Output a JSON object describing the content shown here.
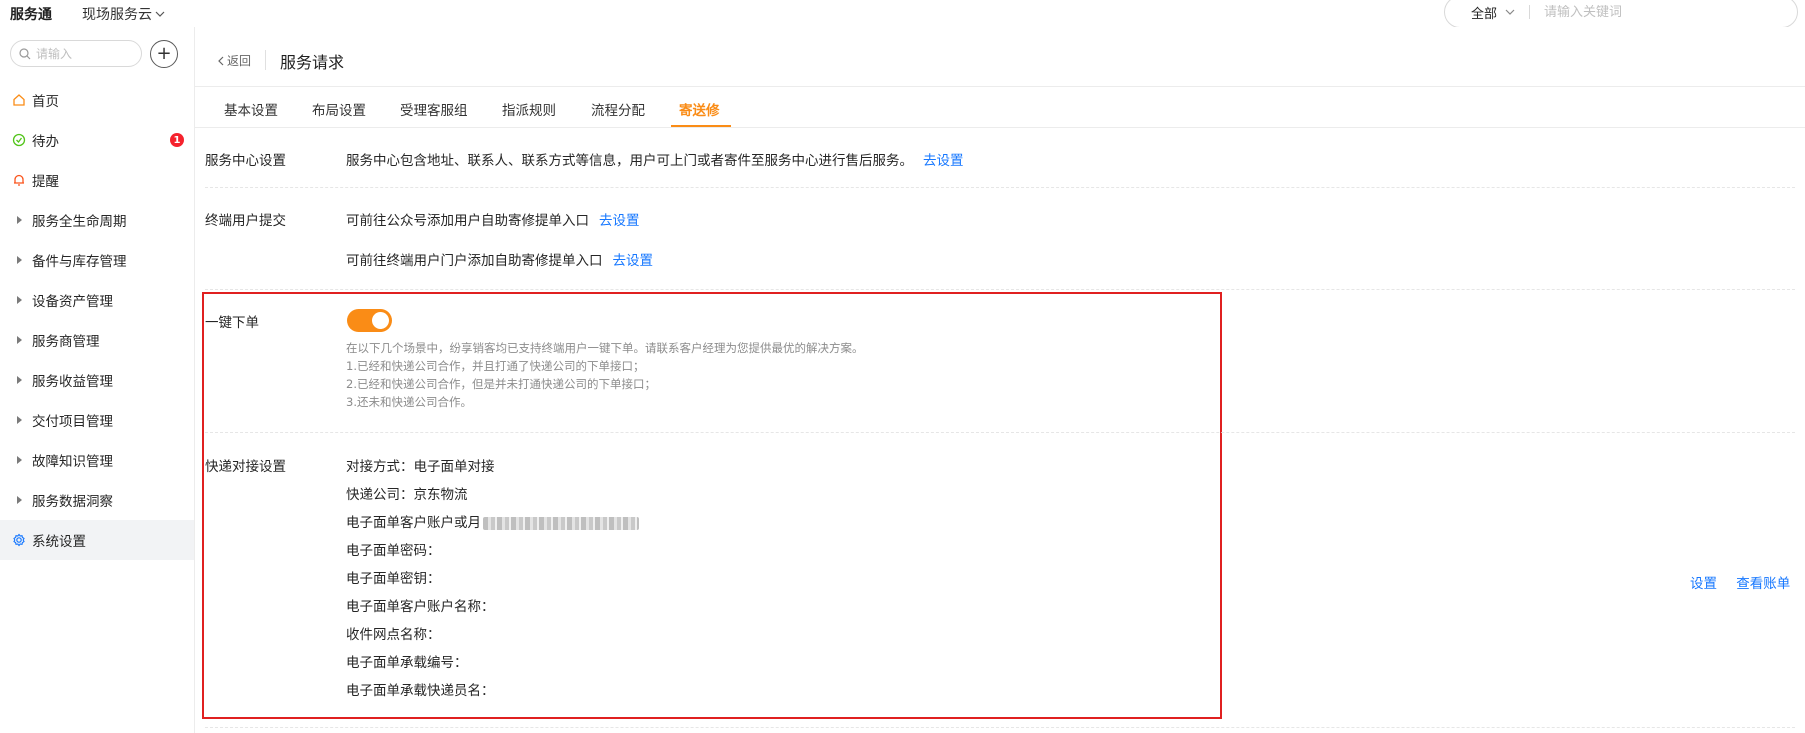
{
  "topbar": {
    "brand": "服务通",
    "app_switch": "现场服务云",
    "scope": "全部",
    "search_placeholder": "请输入关键词"
  },
  "sidebar": {
    "search_placeholder": "请输入",
    "items": [
      {
        "label": "首页",
        "icon": "home-icon"
      },
      {
        "label": "待办",
        "icon": "check-circle-icon",
        "badge": "1"
      },
      {
        "label": "提醒",
        "icon": "bell-icon"
      },
      {
        "label": "服务全生命周期",
        "icon": "caret-right-icon"
      },
      {
        "label": "备件与库存管理",
        "icon": "caret-right-icon"
      },
      {
        "label": "设备资产管理",
        "icon": "caret-right-icon"
      },
      {
        "label": "服务商管理",
        "icon": "caret-right-icon"
      },
      {
        "label": "服务收益管理",
        "icon": "caret-right-icon"
      },
      {
        "label": "交付项目管理",
        "icon": "caret-right-icon"
      },
      {
        "label": "故障知识管理",
        "icon": "caret-right-icon"
      },
      {
        "label": "服务数据洞察",
        "icon": "caret-right-icon"
      },
      {
        "label": "系统设置",
        "icon": "gear-icon"
      }
    ]
  },
  "header": {
    "back": "返回",
    "title": "服务请求"
  },
  "tabs": [
    {
      "label": "基本设置"
    },
    {
      "label": "布局设置"
    },
    {
      "label": "受理客服组"
    },
    {
      "label": "指派规则"
    },
    {
      "label": "流程分配"
    },
    {
      "label": "寄送修"
    }
  ],
  "sections": {
    "service_center": {
      "label": "服务中心设置",
      "text": "服务中心包含地址、联系人、联系方式等信息，用户可上门或者寄件至服务中心进行售后服务。",
      "link": "去设置"
    },
    "end_user": {
      "label": "终端用户提交",
      "line1": "可前往公众号添加用户自助寄修提单入口",
      "line1_link": "去设置",
      "line2": "可前往终端用户门户添加自助寄修提单入口",
      "line2_link": "去设置"
    },
    "one_click": {
      "label": "一键下单",
      "enabled": true,
      "desc": [
        "在以下几个场景中，纷享销客均已支持终端用户一键下单。请联系客户经理为您提供最优的解决方案。",
        "1.已经和快递公司合作，并且打通了快递公司的下单接口；",
        "2.已经和快递公司合作，但是并未打通快递公司的下单接口；",
        "3.还未和快递公司合作。"
      ]
    },
    "express": {
      "label": "快递对接设置",
      "fields": [
        "对接方式：电子面单对接",
        "快递公司：京东物流",
        "电子面单客户账户或月",
        "电子面单密码：",
        "电子面单密钥：",
        "电子面单客户账户名称：",
        "收件网点名称：",
        "电子面单承载编号：",
        "电子面单承载快递员名："
      ],
      "actions": [
        "设置",
        "查看账单"
      ]
    }
  },
  "colors": {
    "accent": "#fa8c16",
    "link": "#1677ff",
    "highlight": "#e02020",
    "badge": "#f5222d"
  }
}
